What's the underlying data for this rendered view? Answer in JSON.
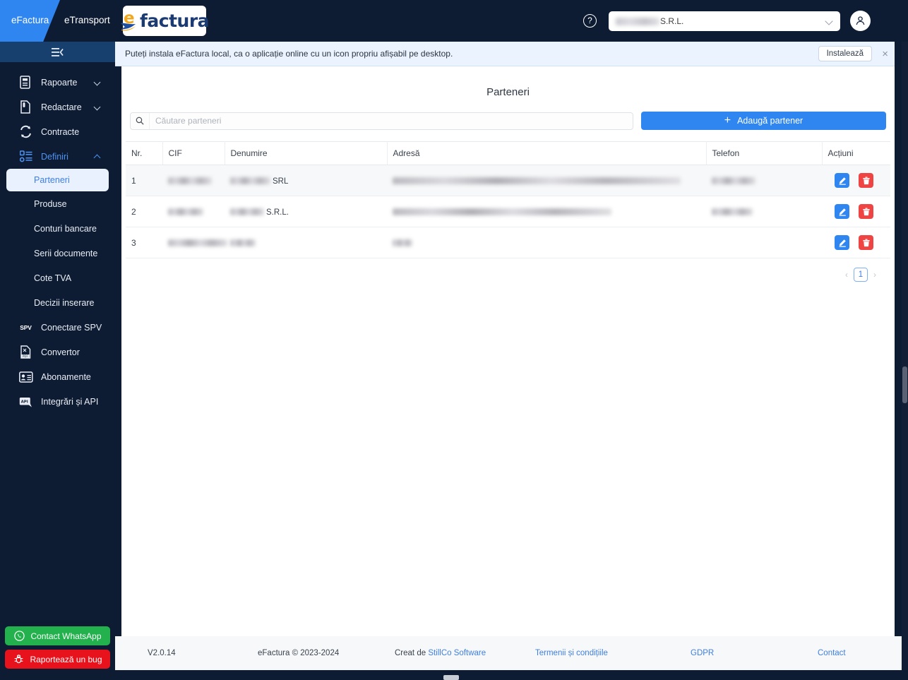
{
  "topbar": {
    "tab_efactura": "eFactura",
    "tab_etransport": "eTransport",
    "logo_e": "e",
    "logo_text": "factura",
    "help_icon": "question-mark-circle-icon",
    "company_name": "S.R.L.",
    "user_icon": "user-avatar-icon",
    "chevron_icon": "chevron-down-icon"
  },
  "sidebar": {
    "collapse_icon": "collapse-menu-icon",
    "items": [
      {
        "label": "Rapoarte",
        "icon": "report-document-icon",
        "expandable": true,
        "expanded": false
      },
      {
        "label": "Redactare",
        "icon": "edit-document-icon",
        "expandable": true,
        "expanded": false
      },
      {
        "label": "Contracte",
        "icon": "sync-arrows-icon",
        "expandable": false
      },
      {
        "label": "Definiri",
        "icon": "list-settings-icon",
        "expandable": true,
        "expanded": true
      }
    ],
    "sub_items": [
      {
        "label": "Parteneri",
        "selected": true
      },
      {
        "label": "Produse",
        "selected": false
      },
      {
        "label": "Conturi bancare",
        "selected": false
      },
      {
        "label": "Serii documente",
        "selected": false
      },
      {
        "label": "Cote TVA",
        "selected": false
      },
      {
        "label": "Decizii inserare",
        "selected": false
      }
    ],
    "items_after": [
      {
        "label": "Conectare SPV",
        "icon": "spv-badge",
        "badge": "SPV"
      },
      {
        "label": "Convertor",
        "icon": "pdf-converter-icon"
      },
      {
        "label": "Abonamente",
        "icon": "subscription-card-icon"
      },
      {
        "label": "Integrări și API",
        "icon": "api-integration-icon"
      }
    ],
    "whatsapp_button": "Contact WhatsApp",
    "whatsapp_icon": "whatsapp-icon",
    "bug_button": "Raportează un bug",
    "bug_icon": "bug-icon"
  },
  "banner": {
    "text": "Puteți instala eFactura local, ca o aplicație online cu un icon propriu afișabil pe desktop.",
    "install_label": "Instalează",
    "close_icon": "close-icon"
  },
  "main": {
    "page_title": "Parteneri",
    "search_placeholder": "Căutare parteneri",
    "search_value": "",
    "search_icon": "search-icon",
    "add_button": "Adaugă partener",
    "add_icon": "plus-icon"
  },
  "table": {
    "columns": [
      "Nr.",
      "CIF",
      "Denumire",
      "Adresă",
      "Telefon",
      "Acțiuni"
    ],
    "rows": [
      {
        "nr": "1",
        "cif": "",
        "cif_blur_w": 62,
        "denumire_blur_w": 57,
        "denumire_suffix": "SRL",
        "adresa": "",
        "adresa_blur_w": 408,
        "telefon_blur_w": 62,
        "edit_icon": "edit-pencil-icon",
        "delete_icon": "trash-delete-icon"
      },
      {
        "nr": "2",
        "cif": "",
        "cif_blur_w": 50,
        "denumire_blur_w": 48,
        "denumire_suffix": "S.R.L.",
        "adresa": "",
        "adresa_blur_w": 310,
        "telefon_blur_w": 58,
        "edit_icon": "edit-pencil-icon",
        "delete_icon": "trash-delete-icon"
      },
      {
        "nr": "3",
        "cif": "",
        "cif_blur_w": 84,
        "denumire_blur_w": 36,
        "denumire_suffix": "",
        "adresa": "",
        "adresa_blur_w": 28,
        "telefon_blur_w": 0,
        "edit_icon": "edit-pencil-icon",
        "delete_icon": "trash-delete-icon"
      }
    ],
    "pagination": {
      "prev": "‹",
      "page": "1",
      "next": "›"
    }
  },
  "footer": {
    "version": "V2.0.14",
    "copyright": "eFactura © 2023-2024",
    "created_prefix": "Creat de ",
    "created_by": "StillCo Software",
    "terms": "Termenii și condițiile",
    "gdpr": "GDPR",
    "contact": "Contact"
  },
  "colors": {
    "accent_blue": "#2f86f0",
    "sidebar_bg": "#0e1c33",
    "danger_red": "#ef4444",
    "whatsapp_green": "#22b14c",
    "bug_red": "#e8121c",
    "link_blue": "#3f7fe0"
  }
}
